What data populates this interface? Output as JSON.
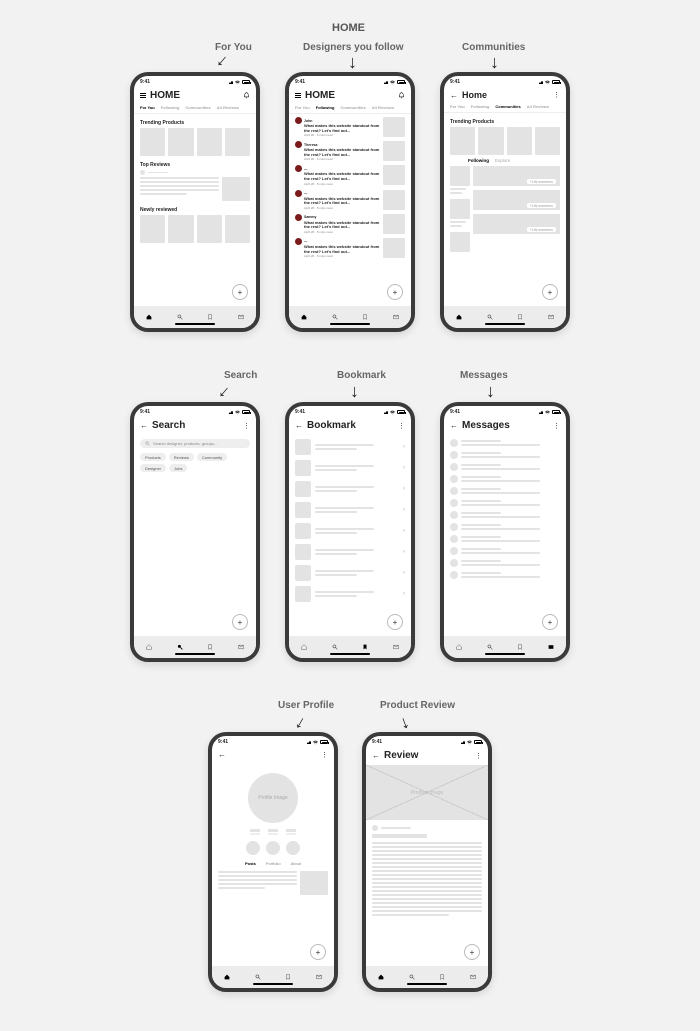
{
  "section_title": "HOME",
  "status_time": "9:41",
  "labels": {
    "for_you": "For You",
    "designers_follow": "Designers you follow",
    "communities": "Communities",
    "search": "Search",
    "bookmark": "Bookmark",
    "messages": "Messages",
    "user_profile": "User Profile",
    "product_review": "Product Review"
  },
  "titles": {
    "home_upper": "HOME",
    "home": "Home",
    "search": "Search",
    "bookmark": "Bookmark",
    "messages": "Messages",
    "review": "Review"
  },
  "tabs": {
    "for_you": "For You",
    "following": "Following",
    "communities": "Communities",
    "all_reviews": "All Reviews",
    "explore": "Explore"
  },
  "sections": {
    "trending": "Trending Products",
    "top_reviews": "Top Reviews",
    "newly_reviewed": "Newly reviewed"
  },
  "feed": {
    "headline": "What makes this website standout from the rest? Let's find out...",
    "meta": "April 26 · 5 mins read",
    "names": [
      "John",
      "Theresa",
      "—",
      "—",
      "Sammy",
      "—"
    ]
  },
  "search": {
    "placeholder": "Search designer, products, groups...",
    "chips": [
      "Products",
      "Reviews",
      "Community",
      "Designer",
      "Jobs"
    ]
  },
  "profile": {
    "placeholder": "Profile Image",
    "tabs": {
      "posts": "Posts",
      "portfolio": "Portfolio",
      "about": "About"
    }
  },
  "review": {
    "product_placeholder": "Product Image"
  },
  "communities_panel": {
    "member_label_1": "+10k members",
    "member_label_2": "+10k members",
    "member_label_3": "+10k members"
  },
  "fab": "+"
}
